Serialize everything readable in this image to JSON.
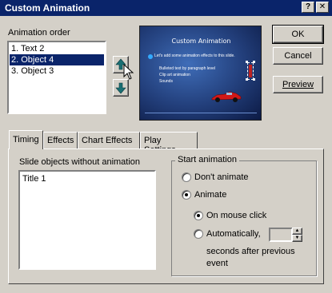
{
  "window": {
    "title": "Custom Animation",
    "help_glyph": "?",
    "close_glyph": "✕"
  },
  "animation_order": {
    "label": "Animation order",
    "items": [
      "1. Text 2",
      "2. Object 4",
      "3. Object 3"
    ],
    "selected_index": 1
  },
  "buttons": {
    "ok": "OK",
    "cancel": "Cancel",
    "preview": "Preview"
  },
  "preview_slide": {
    "title": "Custom Animation",
    "bullet1": "Let's add some animation effects to this slide.",
    "sub1": "Bulleted text by paragraph level",
    "sub2": "Clip art animation",
    "sub3": "Sounds"
  },
  "tabs": [
    "Timing",
    "Effects",
    "Chart Effects",
    "Play Settings"
  ],
  "active_tab": "Timing",
  "timing": {
    "objects_label": "Slide objects without animation",
    "objects": [
      "Title 1"
    ],
    "start_group_label": "Start animation",
    "dont_animate": "Don't animate",
    "animate": "Animate",
    "on_mouse_click": "On mouse click",
    "automatically": "Automatically,",
    "seconds_value": "",
    "seconds_line1": "seconds after previous",
    "seconds_line2": "event",
    "animate_checked": true,
    "on_mouse_click_checked": true
  },
  "colors": {
    "titlebar": "#0a246a",
    "selection": "#0a246a",
    "face": "#d4d0c8"
  }
}
